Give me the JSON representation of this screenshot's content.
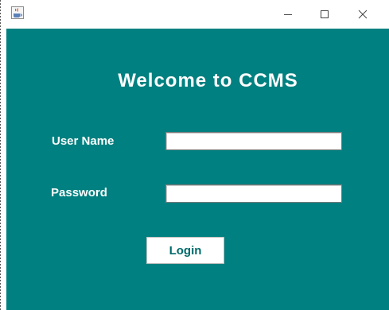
{
  "window": {
    "controls": {
      "minimize_glyph": "—",
      "maximize_glyph": "☐",
      "close_glyph": "✕",
      "app_icon": "java-cup-icon"
    },
    "background_color": "#008080"
  },
  "form": {
    "heading": "Welcome to CCMS",
    "username_label": "User Name",
    "username_value": "",
    "password_label": "Password",
    "password_value": "",
    "login_button": "Login"
  }
}
